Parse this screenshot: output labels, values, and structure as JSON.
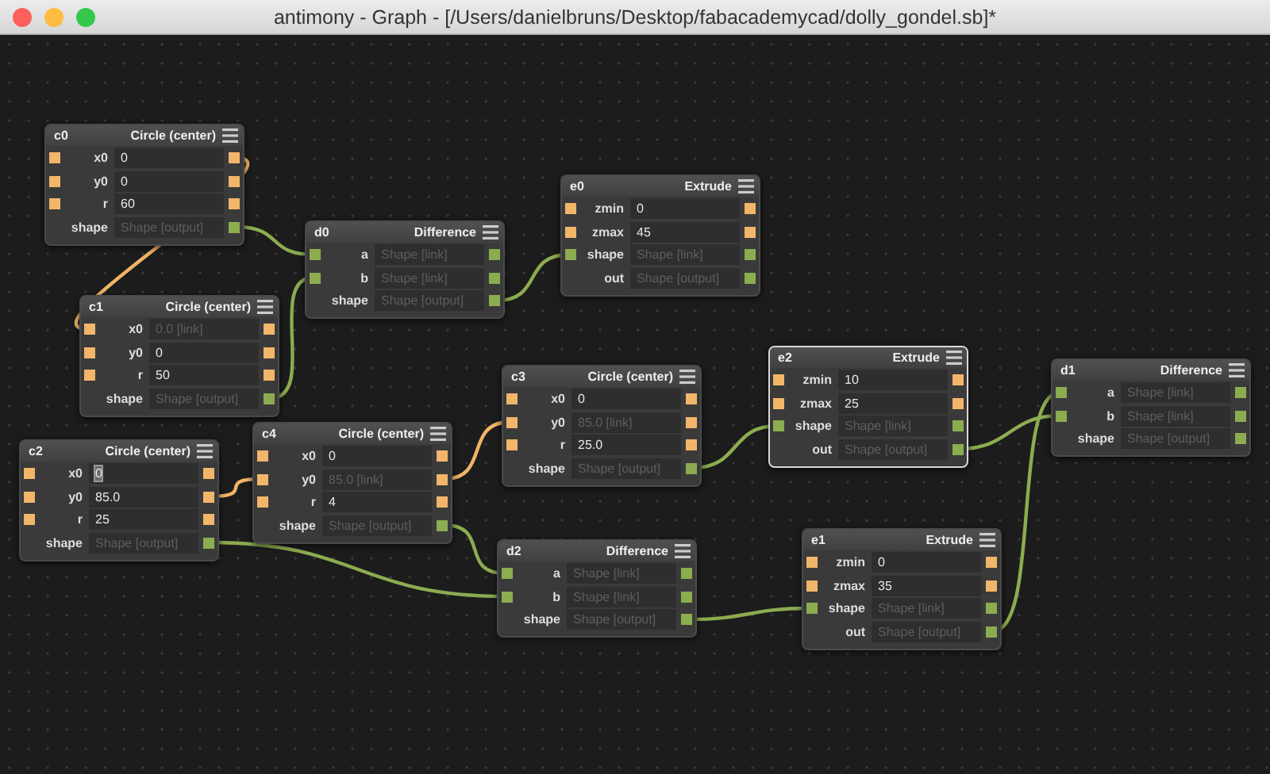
{
  "window": {
    "title": "antimony - Graph - [/Users/danielbruns/Desktop/fabacademycad/dolly_gondel.sb]*"
  },
  "nodes": [
    {
      "id": "c0",
      "type": "Circle (center)",
      "selected": false,
      "rows": [
        {
          "label": "x0",
          "value": "0",
          "kind": "number",
          "editable": true
        },
        {
          "label": "y0",
          "value": "0",
          "kind": "number",
          "editable": true
        },
        {
          "label": "r",
          "value": "60",
          "kind": "number",
          "editable": true
        },
        {
          "label": "shape",
          "value": "Shape [output]",
          "kind": "output",
          "editable": false
        }
      ]
    },
    {
      "id": "d0",
      "type": "Difference",
      "selected": false,
      "rows": [
        {
          "label": "a",
          "value": "Shape [link]",
          "kind": "shape",
          "editable": false
        },
        {
          "label": "b",
          "value": "Shape [link]",
          "kind": "shape",
          "editable": false
        },
        {
          "label": "shape",
          "value": "Shape [output]",
          "kind": "output",
          "editable": false
        }
      ]
    },
    {
      "id": "e0",
      "type": "Extrude",
      "selected": false,
      "rows": [
        {
          "label": "zmin",
          "value": "0",
          "kind": "number",
          "editable": true
        },
        {
          "label": "zmax",
          "value": "45",
          "kind": "number",
          "editable": true
        },
        {
          "label": "shape",
          "value": "Shape [link]",
          "kind": "shape",
          "editable": false
        },
        {
          "label": "out",
          "value": "Shape [output]",
          "kind": "output",
          "editable": false
        }
      ]
    },
    {
      "id": "c1",
      "type": "Circle (center)",
      "selected": false,
      "rows": [
        {
          "label": "x0",
          "value": "0.0 [link]",
          "kind": "number",
          "editable": false
        },
        {
          "label": "y0",
          "value": "0",
          "kind": "number",
          "editable": true
        },
        {
          "label": "r",
          "value": "50",
          "kind": "number",
          "editable": true
        },
        {
          "label": "shape",
          "value": "Shape [output]",
          "kind": "output",
          "editable": false
        }
      ]
    },
    {
      "id": "c3",
      "type": "Circle (center)",
      "selected": false,
      "rows": [
        {
          "label": "x0",
          "value": "0",
          "kind": "number",
          "editable": true
        },
        {
          "label": "y0",
          "value": "85.0 [link]",
          "kind": "number",
          "editable": false
        },
        {
          "label": "r",
          "value": "25.0",
          "kind": "number",
          "editable": true
        },
        {
          "label": "shape",
          "value": "Shape [output]",
          "kind": "output",
          "editable": false
        }
      ]
    },
    {
      "id": "e2",
      "type": "Extrude",
      "selected": true,
      "rows": [
        {
          "label": "zmin",
          "value": "10",
          "kind": "number",
          "editable": true
        },
        {
          "label": "zmax",
          "value": "25",
          "kind": "number",
          "editable": true
        },
        {
          "label": "shape",
          "value": "Shape [link]",
          "kind": "shape",
          "editable": false
        },
        {
          "label": "out",
          "value": "Shape [output]",
          "kind": "output",
          "editable": false
        }
      ]
    },
    {
      "id": "d1",
      "type": "Difference",
      "selected": false,
      "rows": [
        {
          "label": "a",
          "value": "Shape [link]",
          "kind": "shape",
          "editable": false
        },
        {
          "label": "b",
          "value": "Shape [link]",
          "kind": "shape",
          "editable": false
        },
        {
          "label": "shape",
          "value": "Shape [output]",
          "kind": "output",
          "editable": false
        }
      ]
    },
    {
      "id": "c4",
      "type": "Circle (center)",
      "selected": false,
      "rows": [
        {
          "label": "x0",
          "value": "0",
          "kind": "number",
          "editable": true
        },
        {
          "label": "y0",
          "value": "85.0 [link]",
          "kind": "number",
          "editable": false
        },
        {
          "label": "r",
          "value": "4",
          "kind": "number",
          "editable": true
        },
        {
          "label": "shape",
          "value": "Shape [output]",
          "kind": "output",
          "editable": false
        }
      ]
    },
    {
      "id": "c2",
      "type": "Circle (center)",
      "selected": false,
      "rows": [
        {
          "label": "x0",
          "value": "0",
          "kind": "number",
          "editable": true,
          "focused": true
        },
        {
          "label": "y0",
          "value": "85.0",
          "kind": "number",
          "editable": true
        },
        {
          "label": "r",
          "value": "25",
          "kind": "number",
          "editable": true
        },
        {
          "label": "shape",
          "value": "Shape [output]",
          "kind": "output",
          "editable": false
        }
      ]
    },
    {
      "id": "d2",
      "type": "Difference",
      "selected": false,
      "rows": [
        {
          "label": "a",
          "value": "Shape [link]",
          "kind": "shape",
          "editable": false
        },
        {
          "label": "b",
          "value": "Shape [link]",
          "kind": "shape",
          "editable": false
        },
        {
          "label": "shape",
          "value": "Shape [output]",
          "kind": "output",
          "editable": false
        }
      ]
    },
    {
      "id": "e1",
      "type": "Extrude",
      "selected": false,
      "rows": [
        {
          "label": "zmin",
          "value": "0",
          "kind": "number",
          "editable": true
        },
        {
          "label": "zmax",
          "value": "35",
          "kind": "number",
          "editable": true
        },
        {
          "label": "shape",
          "value": "Shape [link]",
          "kind": "shape",
          "editable": false
        },
        {
          "label": "out",
          "value": "Shape [output]",
          "kind": "output",
          "editable": false
        }
      ]
    }
  ]
}
